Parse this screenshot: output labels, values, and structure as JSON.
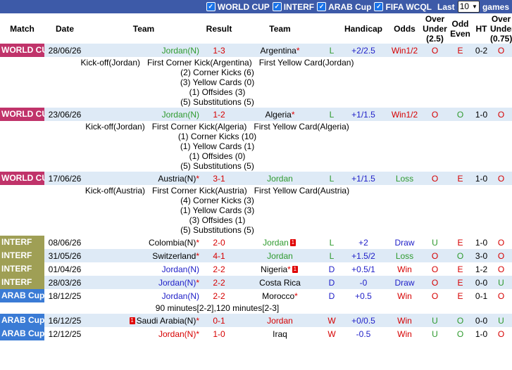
{
  "filters": {
    "items": [
      {
        "label": "WORLD CUP",
        "checked": true
      },
      {
        "label": "INTERF",
        "checked": true
      },
      {
        "label": "ARAB Cup",
        "checked": true
      },
      {
        "label": "FIFA WCQL",
        "checked": true
      }
    ],
    "last_label": "Last",
    "last_value": "10",
    "games_label": "games"
  },
  "headers": [
    "Match",
    "Date",
    "Team",
    "Result",
    "Team",
    "",
    "Handicap",
    "Odds",
    "Over Under (2.5)",
    "Odd Even",
    "HT",
    "Over Under (0.75)"
  ],
  "colors": {
    "world_cup": "#c0336a",
    "interf": "#9f9f55",
    "arab_cup": "#3a7bd5",
    "header_bar": "#3d5aa8",
    "row_light": "#deeaf6"
  },
  "rows": [
    {
      "comp": "WORLD CUP",
      "comp_key": "wc",
      "date": "28/06/26",
      "home": "Jordan(N)",
      "home_style": "green",
      "home_star": false,
      "home_redcard": "",
      "score": "1-3",
      "away": "Argentina",
      "away_style": "",
      "away_star": true,
      "away_redcard": "",
      "wl": "L",
      "handicap": "+2/2.5",
      "odds": "Win1/2",
      "odds_style": "red",
      "ou": "O",
      "oe": "E",
      "ht": "0-2",
      "ou2": "O",
      "details": [
        "Kick-off(Jordan)   First Corner Kick(Argentina)   First Yellow Card(Jordan)",
        "(2) Corner Kicks (6)",
        "(3) Yellow Cards (0)",
        "(1) Offsides (3)",
        "(5) Substitutions (5)"
      ]
    },
    {
      "comp": "WORLD CUP",
      "comp_key": "wc",
      "date": "23/06/26",
      "home": "Jordan(N)",
      "home_style": "green",
      "home_star": false,
      "home_redcard": "",
      "score": "1-2",
      "away": "Algeria",
      "away_style": "",
      "away_star": true,
      "away_redcard": "",
      "wl": "L",
      "handicap": "+1/1.5",
      "odds": "Win1/2",
      "odds_style": "red",
      "ou": "O",
      "oe": "O",
      "ht": "1-0",
      "ou2": "O",
      "details": [
        "Kick-off(Jordan)   First Corner Kick(Algeria)   First Yellow Card(Algeria)",
        "(1) Corner Kicks (10)",
        "(1) Yellow Cards (1)",
        "(1) Offsides (0)",
        "(5) Substitutions (5)"
      ]
    },
    {
      "comp": "WORLD CUP",
      "comp_key": "wc",
      "date": "17/06/26",
      "home": "Austria(N)",
      "home_style": "",
      "home_star": true,
      "home_redcard": "",
      "score": "3-1",
      "away": "Jordan",
      "away_style": "green",
      "away_star": false,
      "away_redcard": "",
      "wl": "L",
      "handicap": "+1/1.5",
      "odds": "Loss",
      "odds_style": "green",
      "ou": "O",
      "oe": "E",
      "ht": "1-0",
      "ou2": "O",
      "details": [
        "Kick-off(Austria)   First Corner Kick(Austria)   First Yellow Card(Austria)",
        "(4) Corner Kicks (3)",
        "(1) Yellow Cards (3)",
        "(3) Offsides (1)",
        "(5) Substitutions (5)"
      ]
    },
    {
      "comp": "INTERF",
      "comp_key": "if",
      "date": "08/06/26",
      "home": "Colombia(N)",
      "home_style": "",
      "home_star": true,
      "home_redcard": "",
      "score": "2-0",
      "away": "Jordan",
      "away_style": "green",
      "away_star": false,
      "away_redcard": "1",
      "wl": "L",
      "handicap": "+2",
      "odds": "Draw",
      "odds_style": "blue",
      "ou": "U",
      "oe": "E",
      "ht": "1-0",
      "ou2": "O",
      "details": []
    },
    {
      "comp": "INTERF",
      "comp_key": "if",
      "date": "31/05/26",
      "home": "Switzerland",
      "home_style": "",
      "home_star": true,
      "home_redcard": "",
      "score": "4-1",
      "away": "Jordan",
      "away_style": "green",
      "away_star": false,
      "away_redcard": "",
      "wl": "L",
      "handicap": "+1.5/2",
      "odds": "Loss",
      "odds_style": "green",
      "ou": "O",
      "oe": "O",
      "ht": "3-0",
      "ou2": "O",
      "details": []
    },
    {
      "comp": "INTERF",
      "comp_key": "if",
      "date": "01/04/26",
      "home": "Jordan(N)",
      "home_style": "blue",
      "home_star": false,
      "home_redcard": "",
      "score": "2-2",
      "away": "Nigeria",
      "away_style": "",
      "away_star": true,
      "away_redcard": "1",
      "wl": "D",
      "handicap": "+0.5/1",
      "odds": "Win",
      "odds_style": "red",
      "ou": "O",
      "oe": "E",
      "ht": "1-2",
      "ou2": "O",
      "details": []
    },
    {
      "comp": "INTERF",
      "comp_key": "if",
      "date": "28/03/26",
      "home": "Jordan(N)",
      "home_style": "blue",
      "home_star": true,
      "home_redcard": "",
      "score": "2-2",
      "away": "Costa Rica",
      "away_style": "",
      "away_star": false,
      "away_redcard": "",
      "wl": "D",
      "handicap": "-0",
      "odds": "Draw",
      "odds_style": "blue",
      "ou": "O",
      "oe": "E",
      "ht": "0-0",
      "ou2": "U",
      "details": []
    },
    {
      "comp": "ARAB Cup",
      "comp_key": "ac",
      "date": "18/12/25",
      "home": "Jordan(N)",
      "home_style": "blue",
      "home_star": false,
      "home_redcard": "",
      "score": "2-2",
      "away": "Morocco",
      "away_style": "",
      "away_star": true,
      "away_redcard": "",
      "wl": "D",
      "handicap": "+0.5",
      "odds": "Win",
      "odds_style": "red",
      "ou": "O",
      "oe": "E",
      "ht": "0-1",
      "ou2": "O",
      "details": [
        "90 minutes[2-2],120 minutes[2-3]"
      ]
    },
    {
      "comp": "ARAB Cup",
      "comp_key": "ac",
      "date": "16/12/25",
      "home": "Saudi Arabia(N)",
      "home_style": "",
      "home_star": true,
      "home_redcard": "1",
      "score": "0-1",
      "away": "Jordan",
      "away_style": "red",
      "away_star": false,
      "away_redcard": "",
      "wl": "W",
      "handicap": "+0/0.5",
      "odds": "Win",
      "odds_style": "red",
      "ou": "U",
      "oe": "O",
      "ht": "0-0",
      "ou2": "U",
      "details": []
    },
    {
      "comp": "ARAB Cup",
      "comp_key": "ac",
      "date": "12/12/25",
      "home": "Jordan(N)",
      "home_style": "red",
      "home_star": true,
      "home_redcard": "",
      "score": "1-0",
      "away": "Iraq",
      "away_style": "",
      "away_star": false,
      "away_redcard": "",
      "wl": "W",
      "handicap": "-0.5",
      "odds": "Win",
      "odds_style": "red",
      "ou": "U",
      "oe": "O",
      "ht": "1-0",
      "ou2": "O",
      "details": []
    }
  ]
}
